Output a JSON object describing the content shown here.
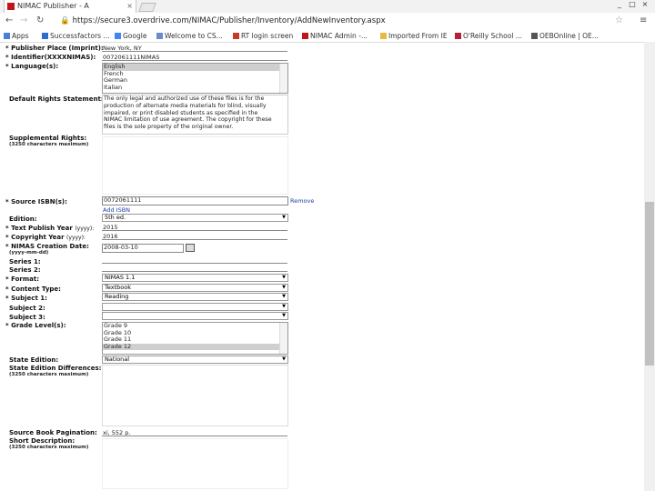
{
  "browser": {
    "tab_title": "NIMAC Publisher - A",
    "tab_close": "×",
    "url": "https://secure3.overdrive.com/NIMAC/Publisher/Inventory/AddNewInventory.aspx",
    "window_controls": [
      "_",
      "□",
      "×"
    ]
  },
  "bookmarks": [
    {
      "label": "Apps",
      "color": "#4a7fd8"
    },
    {
      "label": "Successfactors ...",
      "color": "#2a6fd0"
    },
    {
      "label": "Google",
      "color": "#4285f4"
    },
    {
      "label": "Welcome to CS...",
      "color": "#6b8ccc"
    },
    {
      "label": "RT login screen",
      "color": "#c23b2b"
    },
    {
      "label": "NIMAC Admin -...",
      "color": "#c0151b"
    },
    {
      "label": "Imported From IE",
      "color": "#e8b93a"
    },
    {
      "label": "O'Reilly School ...",
      "color": "#b2223a"
    },
    {
      "label": "OEBOnline | OE...",
      "color": "#555555"
    }
  ],
  "form": {
    "publisher_place_label": "Publisher Place (Imprint):",
    "publisher_place_value": "New York, NY",
    "identifier_label": "Identifier(XXXXNIMAS):",
    "identifier_value": "0072061111NIMAS",
    "language_label": "Language(s):",
    "languages": [
      "English",
      "French",
      "German",
      "Italian"
    ],
    "default_rights_label": "Default Rights Statement:",
    "default_rights_lines": [
      "The only legal and authorized use of these files is for the",
      "production of alternate media materials for blind, visually",
      "impaired, or print disabled students as specified in the",
      "NIMAC limitation of use agreement. The copyright for these",
      "files is the sole property of the original owner."
    ],
    "supplemental_label": "Supplemental Rights:",
    "max_hint": "(3250 characters maximum)",
    "source_isbn_label": "Source ISBN(s):",
    "source_isbn_value": "0072061111",
    "remove_link": "Remove",
    "add_isbn_link": "Add ISBN",
    "edition_label": "Edition:",
    "edition_value": "5th ed.",
    "text_publish_year_label": "Text Publish Year",
    "year_hint": "(yyyy):",
    "text_publish_year_value": "2015",
    "copyright_year_label": "Copyright Year",
    "copyright_year_value": "2016",
    "nimas_creation_label": "NIMAS Creation Date:",
    "date_hint": "(yyyy-mm-dd)",
    "nimas_creation_value": "2008-03-10",
    "series1_label": "Series 1:",
    "series2_label": "Series 2:",
    "format_label": "Format:",
    "format_value": "NIMAS 1.1",
    "content_type_label": "Content Type:",
    "content_type_value": "Textbook",
    "subject1_label": "Subject 1:",
    "subject1_value": "Reading",
    "subject2_label": "Subject 2:",
    "subject3_label": "Subject 3:",
    "grade_level_label": "Grade Level(s):",
    "grades": [
      "Grade 9",
      "Grade 10",
      "Grade 11",
      "Grade 12"
    ],
    "state_edition_label": "State Edition:",
    "state_edition_value": "National",
    "state_edition_diff_label": "State Edition Differences:",
    "source_pagination_label": "Source Book Pagination:",
    "source_pagination_value": "xi, 552 p.",
    "short_description_label": "Short Description:",
    "asterisk": "*",
    "dropdown_arrow": "▼"
  },
  "colors": {
    "accent_link": "#1a3fa8",
    "selection": "#cfcfcf",
    "nimac_red": "#c0151b"
  }
}
